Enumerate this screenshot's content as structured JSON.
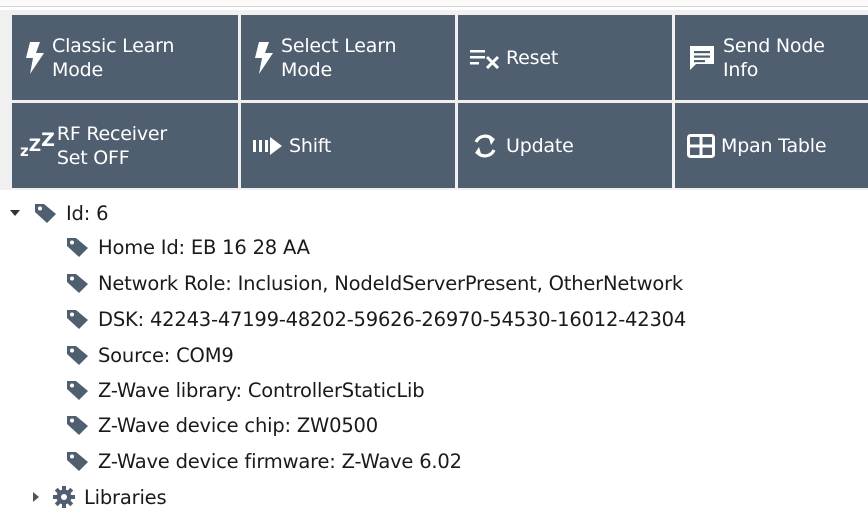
{
  "toolbar": {
    "buttons": [
      {
        "label": "Classic Learn\nMode",
        "icon": "lightning-icon"
      },
      {
        "label": "Select Learn\nMode",
        "icon": "lightning-icon"
      },
      {
        "label": "Reset",
        "icon": "clear-format-icon"
      },
      {
        "label": "Send Node\nInfo",
        "icon": "message-icon"
      },
      {
        "label": "RF Receiver\nSet OFF",
        "icon": "sleep-zzz-icon"
      },
      {
        "label": "Shift",
        "icon": "shift-arrow-icon"
      },
      {
        "label": "Update",
        "icon": "refresh-icon"
      },
      {
        "label": "Mpan Table",
        "icon": "table-icon"
      }
    ],
    "icon_glyphs": {
      "zzz": "zZZ"
    }
  },
  "tree": {
    "root": {
      "label": "Id: 6",
      "expanded": true
    },
    "children": [
      "Home Id: EB 16 28 AA",
      "Network Role: Inclusion, NodeIdServerPresent, OtherNetwork",
      "DSK: 42243-47199-48202-59626-26970-54530-16012-42304",
      "Source: COM9",
      "Z-Wave library: ControllerStaticLib",
      "Z-Wave device chip: ZW0500",
      "Z-Wave device firmware: Z-Wave 6.02"
    ],
    "libraries": {
      "label": "Libraries",
      "expanded": false
    }
  },
  "colors": {
    "button_bg": "#4f5f70",
    "button_text": "#ffffff",
    "tag_icon": "#4f5f70"
  }
}
